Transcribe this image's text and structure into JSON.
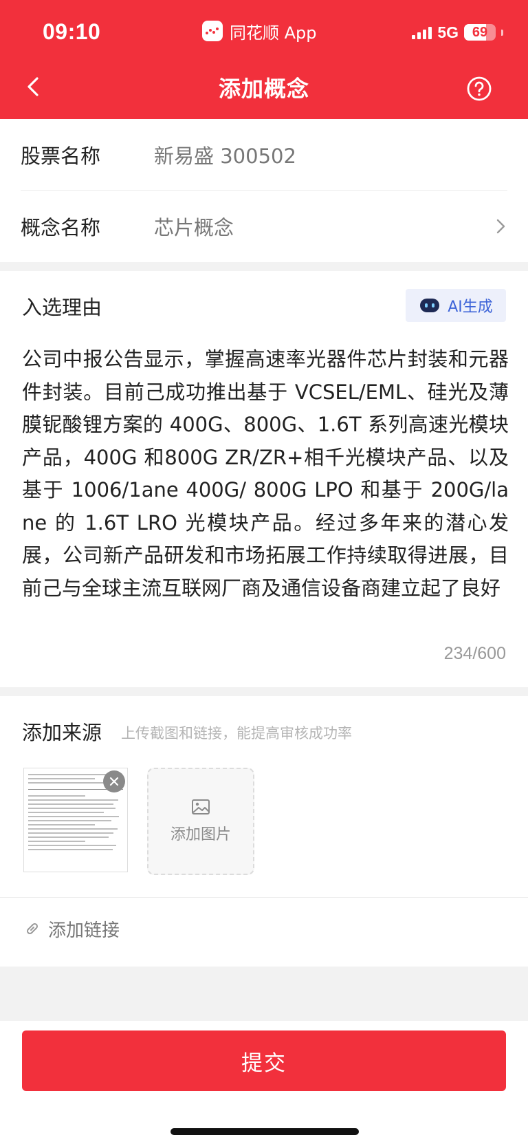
{
  "status_bar": {
    "time": "09:10",
    "app_name": "同花顺 App",
    "network": "5G",
    "battery_level": "69",
    "battery_fraction": 0.69,
    "icons": [
      "signal-icon",
      "battery-icon",
      "app-logo-icon"
    ]
  },
  "nav": {
    "title": "添加概念",
    "back_icon": "chevron-left-icon",
    "help_icon": "help-circle-icon"
  },
  "form": {
    "stock_label": "股票名称",
    "stock_value": "新易盛 300502",
    "concept_label": "概念名称",
    "concept_value": "芯片概念"
  },
  "reason": {
    "title": "入选理由",
    "ai_button": "AI生成",
    "text": "公司中报公告显示，掌握高速率光器件芯片封装和元器件封装。目前己成功推出基于 VCSEL/EML、硅光及薄膜铌酸锂方案的 400G、800G、1.6T 系列高速光模块产品，400G 和800G ZR/ZR+相千光模块产品、以及基于 1006/1ane 400G/ 800G LPO 和基于 200G/lane 的 1.6T LRO 光模块产品。经过多年来的潜心发展，公司新产品研发和市场拓展工作持续取得进展，目前己与全球主流互联网厂商及通信设备商建立起了良好",
    "counter": "234/600"
  },
  "source": {
    "title": "添加来源",
    "hint": "上传截图和链接，能提高审核成功率",
    "add_image_label": "添加图片",
    "add_link_label": "添加链接"
  },
  "submit_label": "提交",
  "colors": {
    "brand_red": "#f2303c",
    "ai_blue": "#3c63d8"
  }
}
